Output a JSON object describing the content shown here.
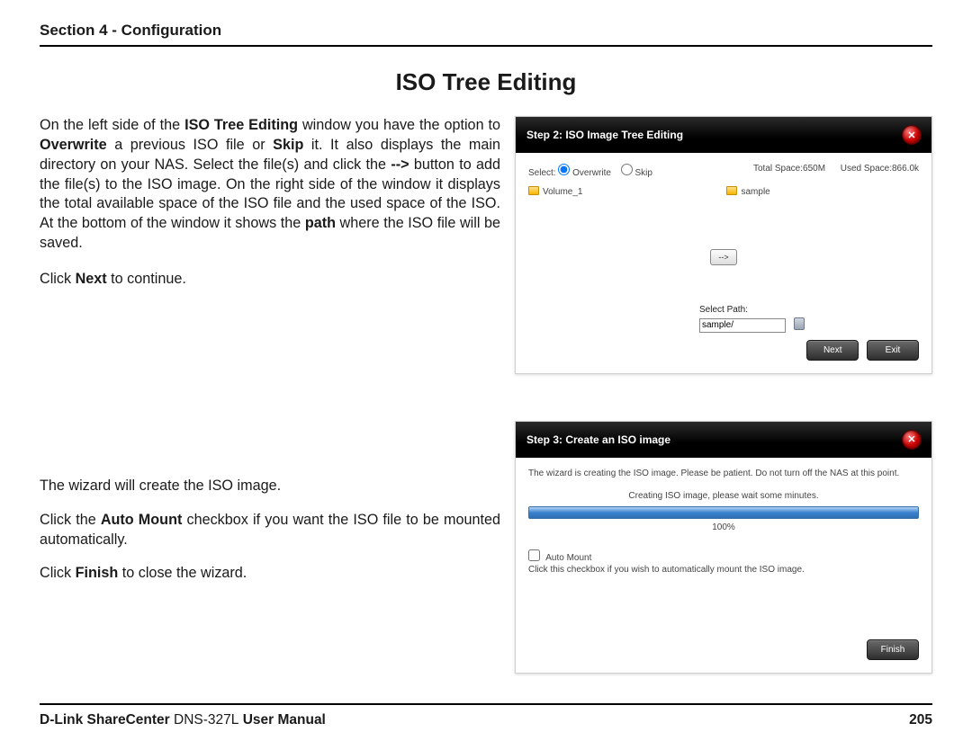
{
  "section_header": "Section 4 - Configuration",
  "page_title": "ISO Tree Editing",
  "para1_parts": {
    "a": "On the left side of the ",
    "b1": "ISO Tree Editing",
    "c": " window you have the option to ",
    "b2": "Overwrite",
    "d": " a previous ISO file or ",
    "b3": "Skip",
    "e": " it. It also displays the main directory on your NAS. Select the file(s) and click the ",
    "b4": "-->",
    "f": " button to add the file(s) to the ISO image. On the right side of the window it displays the total available space of the ISO file and the used space of the ISO. At the bottom of the window it shows the ",
    "b5": "path",
    "g": " where the ISO file will be saved."
  },
  "para2": {
    "a": "Click ",
    "b": "Next",
    "c": " to continue."
  },
  "para3": "The wizard will create the ISO image.",
  "para4": {
    "a": "Click the ",
    "b": "Auto Mount",
    "c": " checkbox if you want the ISO file to be mounted automatically."
  },
  "para5": {
    "a": "Click ",
    "b": "Finish",
    "c": " to close the wizard."
  },
  "panel1": {
    "title": "Step 2: ISO Image Tree Editing",
    "select_label": "Select:",
    "overwrite": "Overwrite",
    "skip": "Skip",
    "total_space": "Total Space:650M",
    "used_space": "Used Space:866.0k",
    "left_folder": "Volume_1",
    "right_folder": "sample",
    "arrow": "-->",
    "select_path_label": "Select Path:",
    "path_value": "sample/",
    "next_btn": "Next",
    "exit_btn": "Exit"
  },
  "panel2": {
    "title": "Step 3: Create an ISO image",
    "wizard_text": "The wizard is creating the ISO image. Please be patient. Do not turn off the NAS at this point.",
    "wait_text": "Creating ISO image, please wait some minutes.",
    "pct": "100%",
    "automount_label": "Auto Mount",
    "automount_desc": "Click this checkbox if you wish to automatically mount the ISO image.",
    "finish_btn": "Finish"
  },
  "footer": {
    "brand_a": "D-Link ShareCenter",
    "brand_b": " DNS-327L",
    "brand_c": " User Manual",
    "page": "205"
  }
}
